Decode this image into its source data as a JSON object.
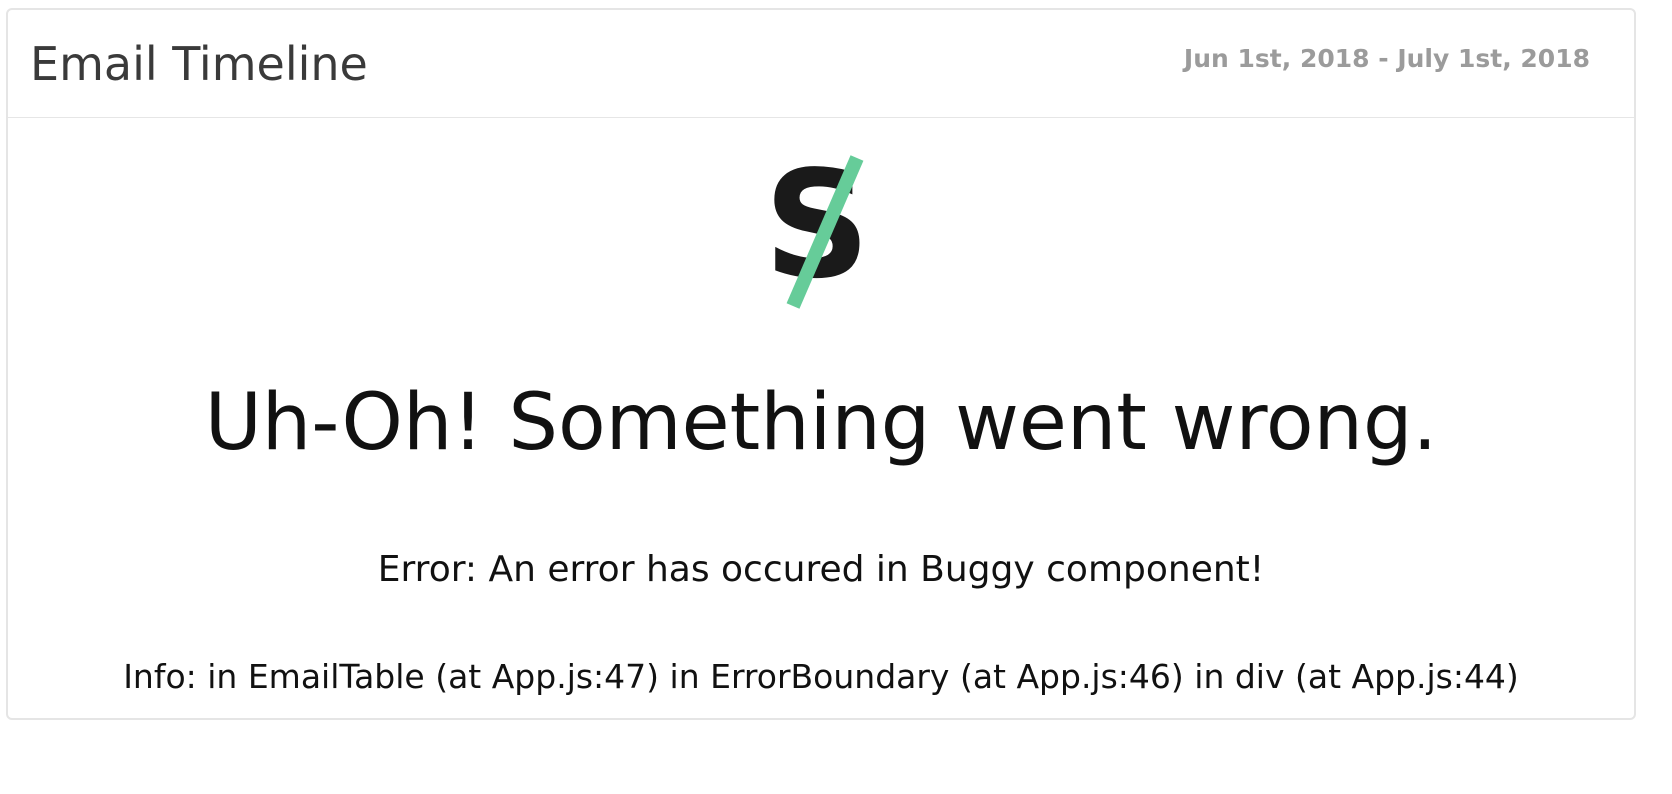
{
  "panel": {
    "title": "Email Timeline",
    "date_range": "Jun 1st, 2018 - July 1st, 2018"
  },
  "logo": {
    "letter": "S",
    "icon": "crossed-out-s-logo-icon",
    "slash_color": "#66cc99",
    "letter_color": "#1a1a1a"
  },
  "error_view": {
    "headline": "Uh-Oh! Something went wrong.",
    "error_message": "Error: An error has occured in Buggy component!",
    "info_message": "Info: in EmailTable (at App.js:47) in ErrorBoundary (at App.js:46) in div (at App.js:44)"
  }
}
